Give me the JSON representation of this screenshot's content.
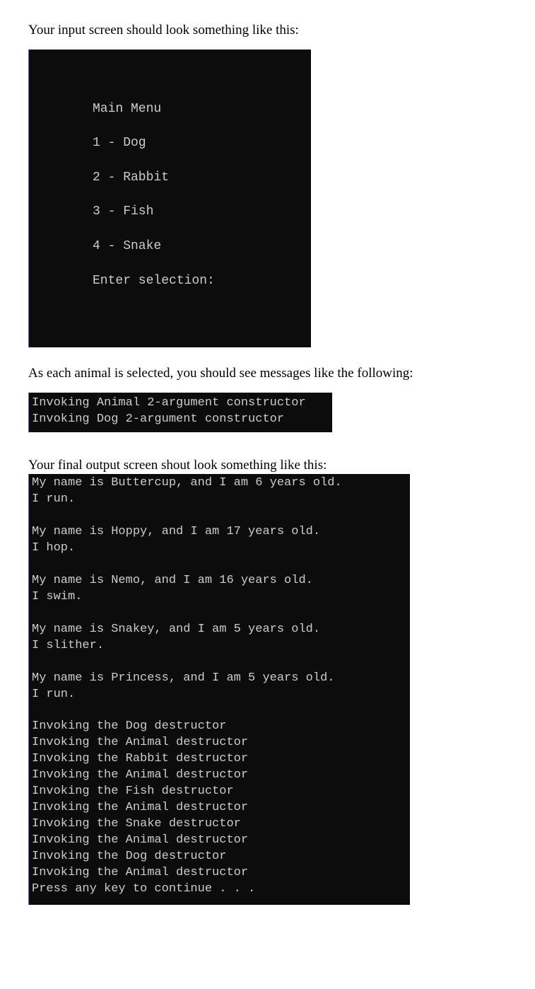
{
  "intro1": "Your input screen should look something like this:",
  "menu": {
    "title": "Main Menu",
    "items": [
      {
        "num": "1",
        "label": "Dog"
      },
      {
        "num": "2",
        "label": "Rabbit"
      },
      {
        "num": "3",
        "label": "Fish"
      },
      {
        "num": "4",
        "label": "Snake"
      }
    ],
    "prompt": "Enter selection:"
  },
  "intro2": "As each animal is selected, you should see messages like the following:",
  "constructors": [
    "Invoking Animal 2-argument constructor",
    "Invoking Dog 2-argument constructor"
  ],
  "intro3": "Your final output screen shout look something like this:",
  "output": {
    "animals": [
      {
        "line1": "My name is Buttercup, and I am 6 years old.",
        "line2": "I run."
      },
      {
        "line1": "My name is Hoppy, and I am 17 years old.",
        "line2": "I hop."
      },
      {
        "line1": "My name is Nemo, and I am 16 years old.",
        "line2": "I swim."
      },
      {
        "line1": "My name is Snakey, and I am 5 years old.",
        "line2": "I slither."
      },
      {
        "line1": "My name is Princess, and I am 5 years old.",
        "line2": "I run."
      }
    ],
    "destructors": [
      "Invoking the Dog destructor",
      "Invoking the Animal destructor",
      "Invoking the Rabbit destructor",
      "Invoking the Animal destructor",
      "Invoking the Fish destructor",
      "Invoking the Animal destructor",
      "Invoking the Snake destructor",
      "Invoking the Animal destructor",
      "Invoking the Dog destructor",
      "Invoking the Animal destructor"
    ],
    "continue": "Press any key to continue . . ."
  }
}
